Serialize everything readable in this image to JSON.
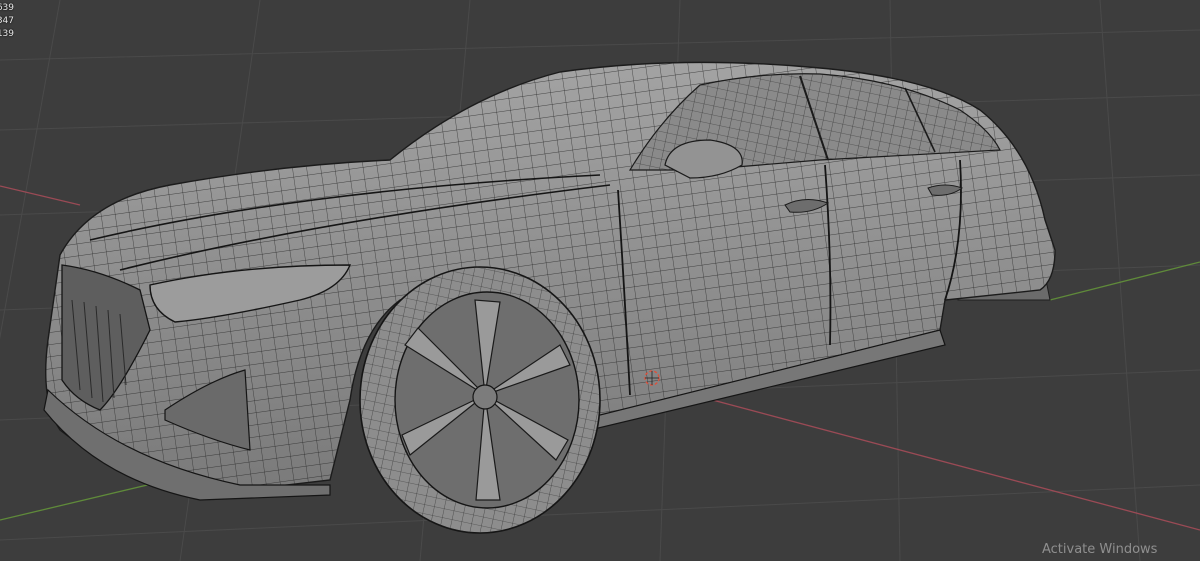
{
  "viewport": {
    "background": "#3d3d3d",
    "grid_color": "#4a4a4a",
    "x_axis_color": "#9a4a55",
    "y_axis_color": "#5f8a3a",
    "mesh_fill": "#8e8e8e",
    "wire_color": "#1e1e1e",
    "origin_color": "#e0503a"
  },
  "stats": {
    "lines": [
      "639",
      "347",
      "139"
    ]
  },
  "watermark": {
    "text": "Activate Windows"
  }
}
